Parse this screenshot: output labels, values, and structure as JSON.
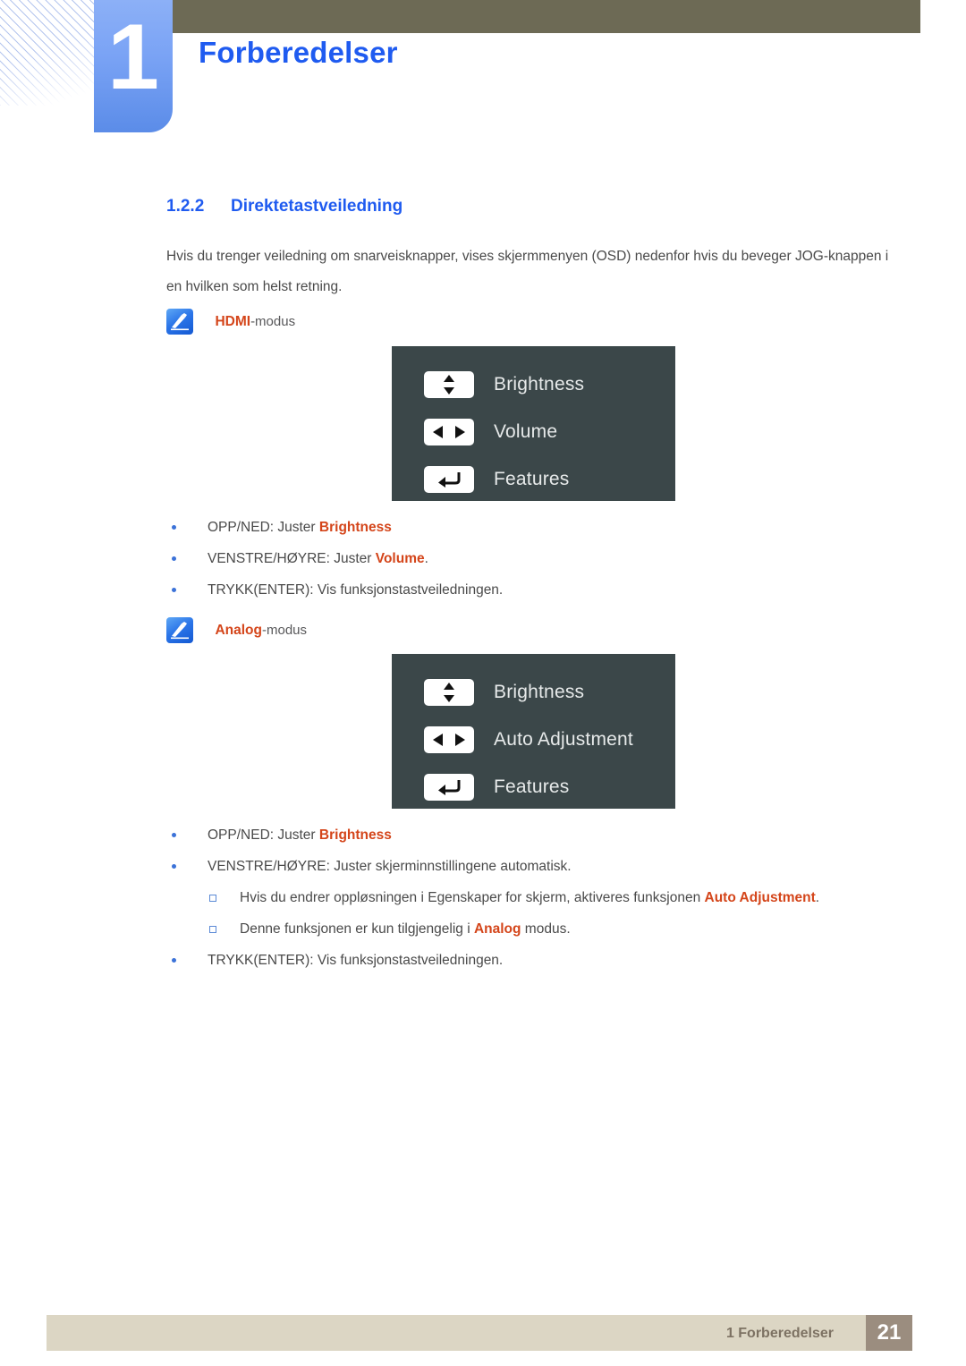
{
  "header": {
    "chapter_number": "1",
    "chapter_title": "Forberedelser"
  },
  "section": {
    "number": "1.2.2",
    "title": "Direktetastveiledning",
    "intro": "Hvis du trenger veiledning om snarveisknapper, vises skjermmenyen (OSD) nedenfor hvis du beveger JOG-knappen i en hvilken som helst retning."
  },
  "hdmi_note": {
    "icon": "note-pen-icon",
    "label_strong": "HDMI",
    "label_rest": "-modus"
  },
  "hdmi_osd": {
    "rows": [
      {
        "key": "up-down-arrows-icon",
        "label": "Brightness"
      },
      {
        "key": "left-right-arrows-icon",
        "label": "Volume"
      },
      {
        "key": "enter-arrow-icon",
        "label": "Features"
      }
    ]
  },
  "hdmi_bullets": [
    {
      "pre": "OPP/NED: Juster ",
      "strong": "Brightness",
      "post": ""
    },
    {
      "pre": "VENSTRE/HØYRE: Juster ",
      "strong": "Volume",
      "post": "."
    },
    {
      "pre": "TRYKK(ENTER): Vis funksjonstastveiledningen.",
      "strong": "",
      "post": ""
    }
  ],
  "analog_note": {
    "icon": "note-pen-icon",
    "label_strong": "Analog",
    "label_rest": "-modus"
  },
  "analog_osd": {
    "rows": [
      {
        "key": "up-down-arrows-icon",
        "label": "Brightness"
      },
      {
        "key": "left-right-arrows-icon",
        "label": "Auto Adjustment"
      },
      {
        "key": "enter-arrow-icon",
        "label": "Features"
      }
    ]
  },
  "analog_bullets": [
    {
      "pre": "OPP/NED: Juster ",
      "strong": "Brightness",
      "post": ""
    },
    {
      "pre": "VENSTRE/HØYRE: Juster skjerminnstillingene automatisk.",
      "strong": "",
      "post": ""
    }
  ],
  "analog_subbullets": [
    {
      "pre": "Hvis du endrer oppløsningen i Egenskaper for skjerm, aktiveres funksjonen ",
      "strong": "Auto Adjustment",
      "post": "."
    },
    {
      "pre": "Denne funksjonen er kun tilgjengelig i ",
      "strong": "Analog",
      "post": " modus."
    }
  ],
  "analog_bullets_tail": [
    {
      "pre": "TRYKK(ENTER): Vis funksjonstastveiledningen.",
      "strong": "",
      "post": ""
    }
  ],
  "footer": {
    "text": "1 Forberedelser",
    "page": "21"
  },
  "colors": {
    "accent_blue": "#1f5bf0",
    "highlight_orange": "#d4451a",
    "osd_background": "#3b4749",
    "header_bar": "#6d6a55",
    "footer_bar": "#dcd6c4",
    "footer_page_box": "#9b8d7f"
  }
}
